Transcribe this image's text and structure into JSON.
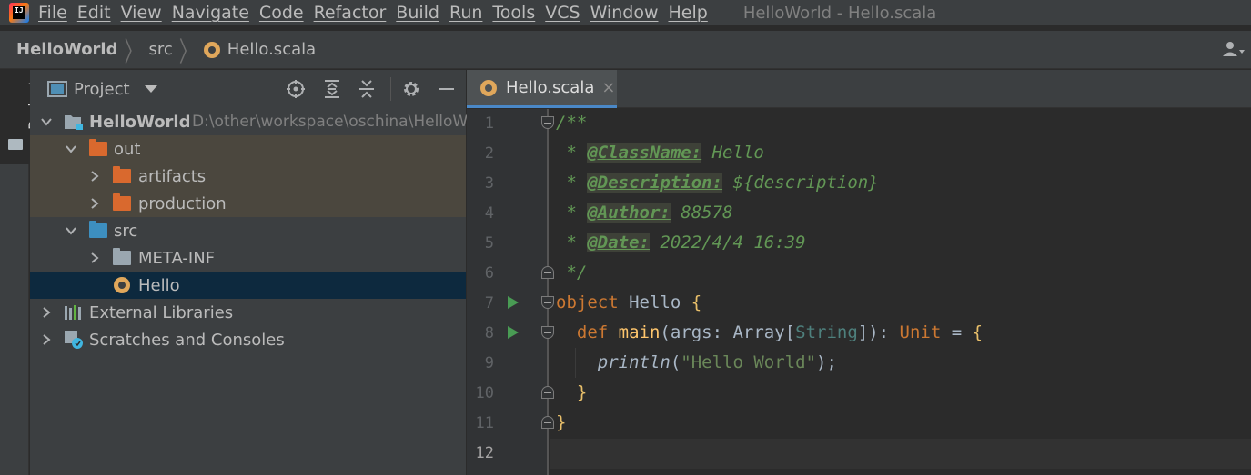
{
  "menubar": {
    "items": [
      "File",
      "Edit",
      "View",
      "Navigate",
      "Code",
      "Refactor",
      "Build",
      "Run",
      "Tools",
      "VCS",
      "Window",
      "Help"
    ],
    "window_title": "HelloWorld - Hello.scala"
  },
  "breadcrumb": {
    "project": "HelloWorld",
    "folder": "src",
    "file": "Hello.scala"
  },
  "left_stripe": {
    "project_tab": "Project"
  },
  "project_panel": {
    "title": "Project",
    "tree": [
      {
        "label": "HelloWorld",
        "path": "D:\\other\\workspace\\oschina\\HelloW"
      },
      {
        "label": "out"
      },
      {
        "label": "artifacts"
      },
      {
        "label": "production"
      },
      {
        "label": "src"
      },
      {
        "label": "META-INF"
      },
      {
        "label": "Hello"
      },
      {
        "label": "External Libraries"
      },
      {
        "label": "Scratches and Consoles"
      }
    ]
  },
  "editor": {
    "tab_label": "Hello.scala",
    "tab_close": "×",
    "line_numbers": [
      "1",
      "2",
      "3",
      "4",
      "5",
      "6",
      "7",
      "8",
      "9",
      "10",
      "11",
      "12"
    ],
    "code": {
      "l1": "/**",
      "l2_star": " * ",
      "l2_tag": "@ClassName:",
      "l2_val": " Hello",
      "l3_star": " * ",
      "l3_tag": "@Description:",
      "l3_val": " ${description}",
      "l4_star": " * ",
      "l4_tag": "@Author:",
      "l4_val": " 88578",
      "l5_star": " * ",
      "l5_tag": "@Date:",
      "l5_val": " 2022/4/4 16:39",
      "l6": " */",
      "l7_kw": "object",
      "l7_name": " Hello ",
      "l7_brace": "{",
      "l8_indent": "  ",
      "l8_kw": "def",
      "l8_fn": " main",
      "l8_paren": "(args: Array[",
      "l8_type": "String",
      "l8_close": "]): ",
      "l8_unit": "Unit",
      "l8_eq": " = ",
      "l8_brace": "{",
      "l9_indent": "    ",
      "l9_fn": "println",
      "l9_open": "(",
      "l9_str": "\"Hello World\"",
      "l9_close": ");",
      "l10": "  }",
      "l11": "}"
    }
  }
}
